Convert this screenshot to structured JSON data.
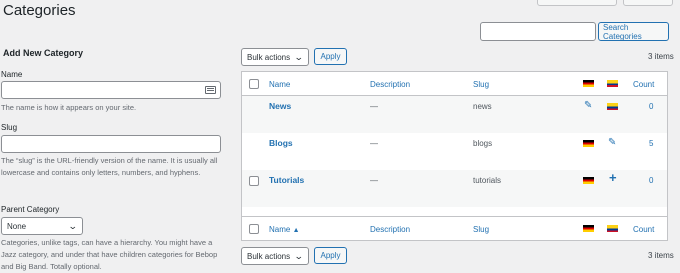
{
  "page": {
    "title": "Categories"
  },
  "search": {
    "placeholder": "",
    "button_label": "Search Categories"
  },
  "form": {
    "heading": "Add New Category",
    "name_label": "Name",
    "name_help": "The name is how it appears on your site.",
    "slug_label": "Slug",
    "slug_help": "The “slug” is the URL-friendly version of the name. It is usually all lowercase and contains only letters, numbers, and hyphens.",
    "parent_label": "Parent Category",
    "parent_value": "None",
    "parent_help": "Categories, unlike tags, can have a hierarchy. You might have a Jazz category, and under that have children categories for Bebop and Big Band. Totally optional."
  },
  "bulk": {
    "label": "Bulk actions",
    "apply": "Apply",
    "count": "3 items"
  },
  "table": {
    "columns": {
      "name": "Name",
      "description": "Description",
      "slug": "Slug",
      "count": "Count"
    },
    "sort_indicator": "▲",
    "rows": [
      {
        "name": "News",
        "description": "—",
        "slug": "news",
        "count": "0",
        "de_action": "pencil-icon",
        "co_action": "flag-icon"
      },
      {
        "name": "Blogs",
        "description": "—",
        "slug": "blogs",
        "count": "5",
        "de_action": "flag-icon",
        "co_action": "pencil-icon"
      },
      {
        "name": "Tutorials",
        "description": "—",
        "slug": "tutorials",
        "count": "0",
        "de_action": "flag-icon",
        "co_action": "plus-icon"
      }
    ]
  },
  "colors": {
    "accent": "#2271b1",
    "background": "#f0f0f1",
    "border": "#c3c4c7"
  },
  "icons": {
    "pencil": "✎",
    "plus": "+",
    "chevron": "⌄"
  }
}
